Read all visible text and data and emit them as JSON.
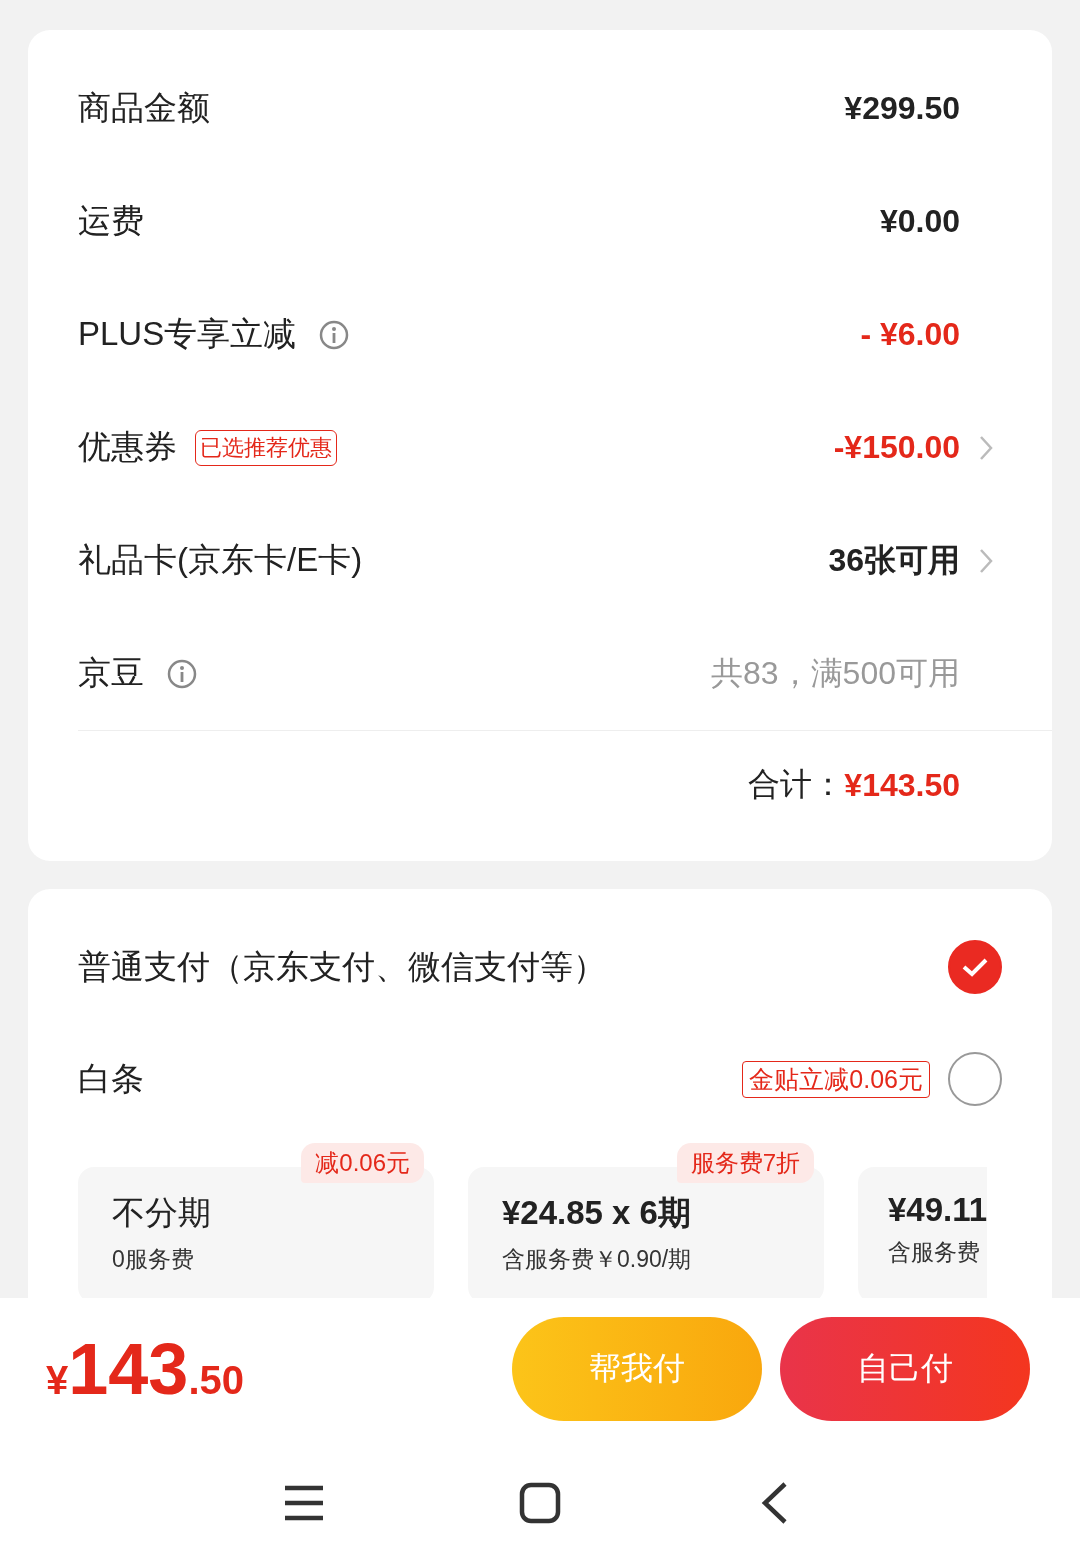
{
  "summary": {
    "rows": [
      {
        "label": "商品金额",
        "info": false,
        "value": "¥299.50",
        "kind": "normal",
        "chevron": false
      },
      {
        "label": "运费",
        "info": false,
        "value": "¥0.00",
        "kind": "normal",
        "chevron": false
      },
      {
        "label": "PLUS专享立减",
        "info": true,
        "value": "- ¥6.00",
        "kind": "discount",
        "chevron": false
      },
      {
        "label": "优惠券",
        "info": false,
        "tag": "已选推荐优惠",
        "value": "-¥150.00",
        "kind": "discount",
        "chevron": true
      },
      {
        "label": "礼品卡(京东卡/E卡)",
        "info": false,
        "value": "36张可用",
        "kind": "normal",
        "chevron": true
      },
      {
        "label": "京豆",
        "info": true,
        "value": "共83，满500可用",
        "kind": "muted",
        "chevron": false
      }
    ],
    "total": {
      "label": "合计：",
      "value": "¥143.50"
    }
  },
  "payment": {
    "methods": [
      {
        "label": "普通支付（京东支付、微信支付等）",
        "selected": true
      },
      {
        "label": "白条",
        "tag": "金贴立减0.06元",
        "selected": false
      }
    ],
    "plans": [
      {
        "title": "不分期",
        "subtitle": "0服务费",
        "badge": "减0.06元"
      },
      {
        "title": "¥24.85 x 6期",
        "subtitle": "含服务费￥0.90/期",
        "badge": "服务费7折"
      },
      {
        "title": "¥49.11",
        "subtitle": "含服务费"
      }
    ]
  },
  "footer": {
    "price": {
      "currency": "¥",
      "integer": "143",
      "decimal": ".50"
    },
    "buttons": [
      {
        "label": "帮我付",
        "kind": "secondary"
      },
      {
        "label": "自己付",
        "kind": "primary"
      }
    ]
  }
}
